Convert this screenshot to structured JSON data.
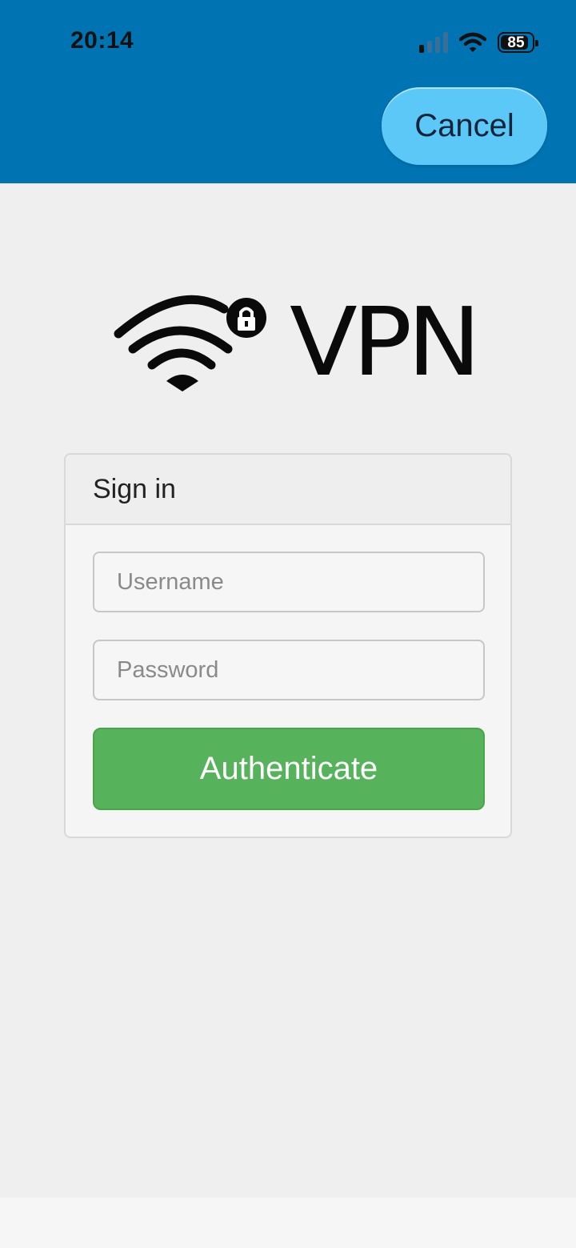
{
  "status_bar": {
    "time": "20:14",
    "battery_level": "85",
    "icons": [
      "cellular-signal-icon",
      "wifi-icon",
      "battery-icon"
    ]
  },
  "header": {
    "cancel_label": "Cancel"
  },
  "logo": {
    "text": "VPN",
    "icons": [
      "wifi-lock-icon"
    ]
  },
  "signin": {
    "title": "Sign in",
    "username_placeholder": "Username",
    "username_value": "",
    "password_placeholder": "Password",
    "password_value": "",
    "submit_label": "Authenticate"
  },
  "colors": {
    "header_bg": "#0074b3",
    "cancel_bg": "#5bc8f7",
    "page_bg": "#efefef",
    "submit_bg": "#56b35b"
  }
}
